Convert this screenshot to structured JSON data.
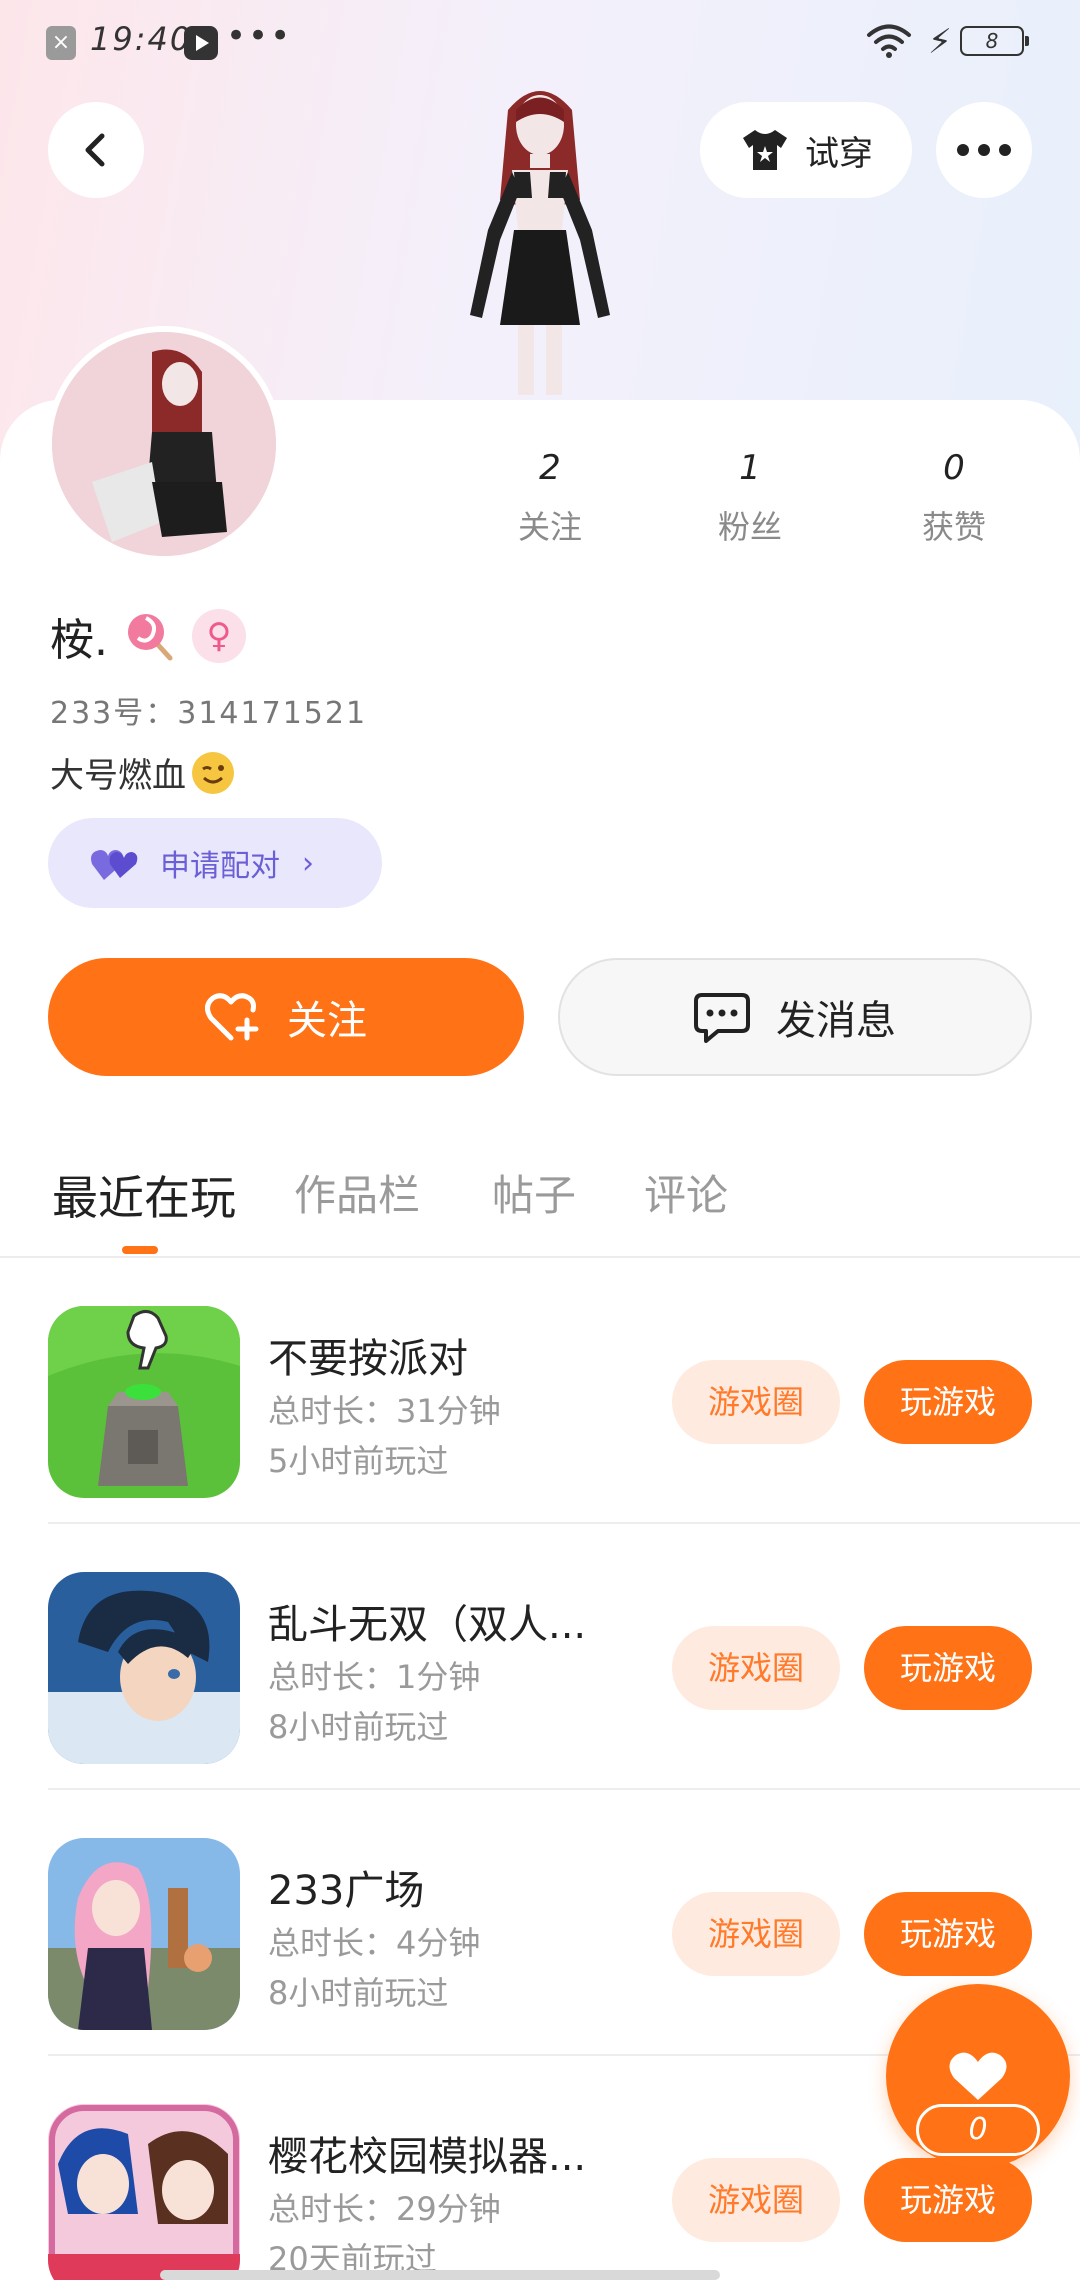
{
  "status_bar": {
    "time": "19:40",
    "dots": "•••",
    "battery_level": "8"
  },
  "header": {
    "back_icon": "chevron-left-icon",
    "try_on_label": "试穿",
    "try_on_icon": "shirt-icon",
    "more_icon": "more-horizontal-icon"
  },
  "profile": {
    "username": "桉.",
    "gender_symbol": "♀",
    "id_line": "233号：314171521",
    "bio": "大号燃血",
    "pair_label": "申请配对",
    "stats": [
      {
        "value": "2",
        "label": "关注"
      },
      {
        "value": "1",
        "label": "粉丝"
      },
      {
        "value": "0",
        "label": "获赞"
      }
    ]
  },
  "actions": {
    "follow_label": "关注",
    "message_label": "发消息"
  },
  "tabs": [
    {
      "label": "最近在玩",
      "active": true
    },
    {
      "label": "作品栏",
      "active": false
    },
    {
      "label": "帖子",
      "active": false
    },
    {
      "label": "评论",
      "active": false
    }
  ],
  "games": [
    {
      "name": "不要按派对",
      "duration": "总时长：31分钟",
      "last_played": "5小时前玩过",
      "circle_label": "游戏圈",
      "play_label": "玩游戏"
    },
    {
      "name": "乱斗无双（双人...",
      "duration": "总时长：1分钟",
      "last_played": "8小时前玩过",
      "circle_label": "游戏圈",
      "play_label": "玩游戏"
    },
    {
      "name": "233广场",
      "duration": "总时长：4分钟",
      "last_played": "8小时前玩过",
      "circle_label": "游戏圈",
      "play_label": "玩游戏"
    },
    {
      "name": "樱花校园模拟器...",
      "duration": "总时长：29分钟",
      "last_played": "20天前玩过",
      "circle_label": "游戏圈",
      "play_label": "玩游戏"
    }
  ],
  "like_fab": {
    "count": "0",
    "icon": "heart-icon"
  },
  "colors": {
    "accent": "#ff7215",
    "accent_soft": "#ffeadf",
    "pair_bg": "#e9e7fb",
    "pair_text": "#6b5fd6"
  }
}
